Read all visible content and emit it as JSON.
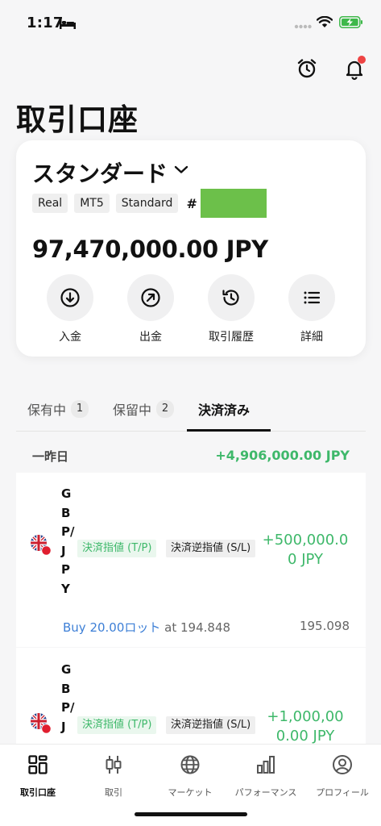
{
  "status_bar": {
    "time": "1:17",
    "battery_color": "#3eb84a"
  },
  "header": {
    "title": "取引口座",
    "icons": [
      "alarm-clock-icon",
      "bell-icon"
    ]
  },
  "account": {
    "name": "スタンダード",
    "tags": [
      "Real",
      "MT5",
      "Standard"
    ],
    "number_prefix": "#",
    "balance": "97,470,000.00 JPY",
    "actions": [
      {
        "label": "入金",
        "icon": "deposit-icon"
      },
      {
        "label": "出金",
        "icon": "withdraw-icon"
      },
      {
        "label": "取引履歴",
        "icon": "history-icon"
      },
      {
        "label": "詳細",
        "icon": "list-icon"
      }
    ]
  },
  "tabs": [
    {
      "label": "保有中",
      "count": "1"
    },
    {
      "label": "保留中",
      "count": "2"
    },
    {
      "label": "決済済み",
      "count": ""
    }
  ],
  "day_group": {
    "label": "一昨日",
    "total": "+4,906,000.00 JPY"
  },
  "trades": [
    {
      "symbol": "GBP/JPY",
      "tp_badge": "決済指値 (T/P)",
      "sl_badge": "決済逆指値 (S/L)",
      "profit": "+500,000.00 JPY",
      "direction": "Buy 20.00ロット",
      "open_info": " at 194.848",
      "close_price": "195.098"
    },
    {
      "symbol": "GBP/J",
      "tp_badge": "決済指値 (T/P)",
      "sl_badge": "決済逆指値 (S/L)",
      "profit": "+1,000,000.00 JPY"
    }
  ],
  "bottom_nav": [
    {
      "label": "取引口座",
      "icon": "dashboard-icon",
      "active": true
    },
    {
      "label": "取引",
      "icon": "candlestick-icon"
    },
    {
      "label": "マーケット",
      "icon": "globe-icon"
    },
    {
      "label": "パフォーマンス",
      "icon": "bar-chart-icon"
    },
    {
      "label": "プロフィール",
      "icon": "profile-icon"
    }
  ],
  "colors": {
    "profit_green": "#3eb86a",
    "buy_blue": "#3d7fd6",
    "alert_red": "#ee4444"
  }
}
